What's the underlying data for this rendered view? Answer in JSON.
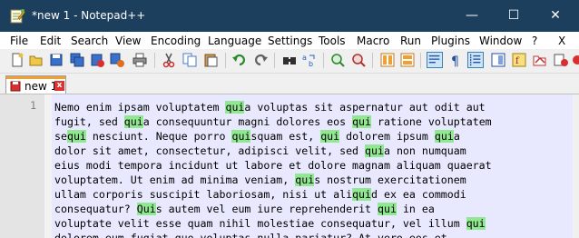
{
  "window": {
    "title": "*new 1 - Notepad++",
    "minimize": "—",
    "maximize": "☐",
    "close": "✕"
  },
  "menu": [
    "File",
    "Edit",
    "Search",
    "View",
    "Encoding",
    "Language",
    "Settings",
    "Tools",
    "Macro",
    "Run",
    "Plugins",
    "Window",
    "?",
    "X"
  ],
  "toolbar_icons": [
    "new-file-icon",
    "open-file-icon",
    "save-icon",
    "save-all-icon",
    "close-icon",
    "close-all-icon",
    "print-icon",
    "cut-icon",
    "copy-icon",
    "paste-icon",
    "undo-icon",
    "redo-icon",
    "find-icon",
    "replace-icon",
    "zoom-in-icon",
    "zoom-out-icon",
    "sync-vertical-icon",
    "sync-horizontal-icon",
    "word-wrap-icon",
    "show-all-characters-icon",
    "indent-guide-icon",
    "document-map-icon",
    "function-list-icon",
    "folder-as-workspace-icon",
    "monitoring-icon",
    "record-macro-icon"
  ],
  "tab": {
    "label": "new 1",
    "close": "x"
  },
  "editor": {
    "line_number": "1",
    "search_term": "qui",
    "lines": [
      "Nemo enim ipsam voluptatem quia voluptas sit aspernatur aut odit aut",
      "fugit, sed quia consequuntur magni dolores eos qui ratione voluptatem",
      "sequi nesciunt. Neque porro quisquam est, qui dolorem ipsum quia",
      "dolor sit amet, consectetur, adipisci velit, sed quia non numquam",
      "eius modi tempora incidunt ut labore et dolore magnam aliquam quaerat",
      "voluptatem. Ut enim ad minima veniam, quis nostrum exercitationem",
      "ullam corporis suscipit laboriosam, nisi ut aliquid ex ea commodi",
      "consequatur? Quis autem vel eum iure reprehenderit qui in ea",
      "voluptate velit esse quam nihil molestiae consequatur, vel illum qui",
      "dolorem eum fugiat quo voluptas nulla pariatur? At vero eos et"
    ]
  },
  "colors": {
    "titlebar": "#1d3f5e",
    "editor_background": "#e8e8ff",
    "highlight": "#90e890",
    "tab_accent": "#f0a030"
  }
}
